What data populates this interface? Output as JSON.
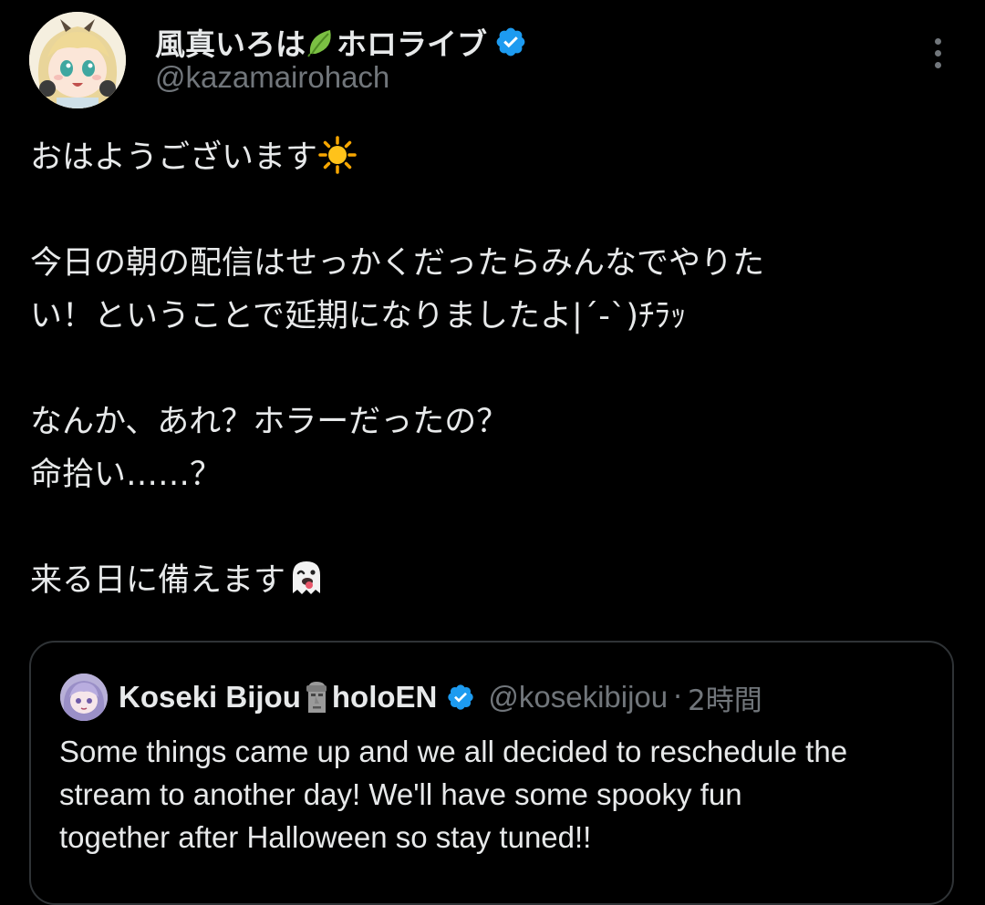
{
  "tweet": {
    "author": {
      "name_before_emoji": "風真いろは",
      "name_emoji": "leaf-icon",
      "name_after_emoji": "ホロライブ",
      "handle": "@kazamairohach",
      "verified": true
    },
    "more_icon": "more-vertical-icon",
    "body": {
      "line1": "おはようございます",
      "line1_emoji": "sun-icon",
      "line2": "今日の朝の配信はせっかくだったらみんなでやりた",
      "line3": "い！ということで延期になりましたよ|´-`)ﾁﾗｯ",
      "line4": "なんか、あれ？ホラーだったの？",
      "line5": "命拾い……？",
      "line6": "来る日に備えます",
      "line6_emoji": "ghost-icon"
    },
    "quote": {
      "name_before_emoji": "Koseki Bijou",
      "name_emoji": "moai-icon",
      "name_after_emoji": "holoEN",
      "verified": true,
      "handle": "@kosekibijou",
      "separator": "·",
      "time": "2時間",
      "text_line1": "Some things came up and we all decided to reschedule the",
      "text_line2": "stream to another day! We'll have some spooky fun",
      "text_line3": "together after Halloween so stay tuned!!"
    }
  },
  "colors": {
    "background": "#000000",
    "primary_text": "#e7e9ea",
    "secondary_text": "#71767b",
    "verified_blue": "#1d9bf0",
    "border": "#2f3336"
  }
}
